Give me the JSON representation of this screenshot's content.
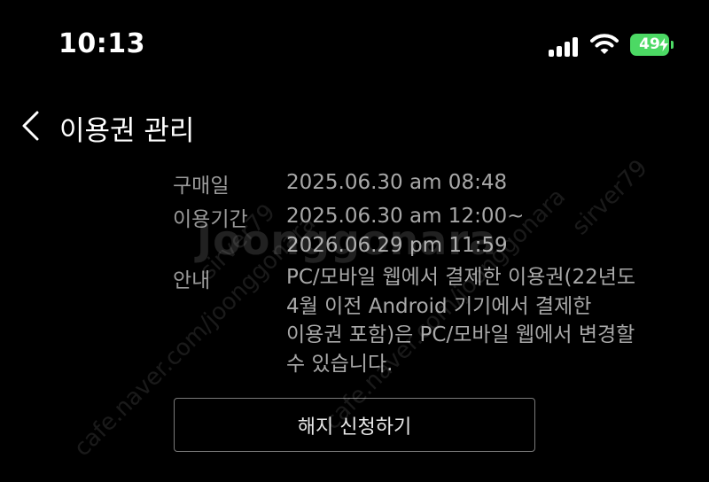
{
  "status_bar": {
    "time": "10:13",
    "battery_level": "49",
    "icons": [
      "signal-icon",
      "wifi-icon",
      "battery-charging-icon"
    ]
  },
  "header": {
    "back_icon": "chevron-left-icon",
    "title": "이용권 관리"
  },
  "info": {
    "purchase_date": {
      "label": "구매일",
      "value": "2025.06.30 am 08:48"
    },
    "usage_period": {
      "label": "이용기간",
      "value_line1": "2025.06.30 am 12:00~",
      "value_line2": "2026.06.29 pm 11:59"
    },
    "notice": {
      "label": "안내",
      "lines": [
        "PC/모바일 웹에서 결제한 이용권(22년도",
        "4월 이전 Android 기기에서 결제한",
        "이용권 포함)은 PC/모바일 웹에서 변경할",
        "수 있습니다."
      ]
    }
  },
  "actions": {
    "cancel_label": "해지 신청하기"
  },
  "watermark": {
    "brand": "Joonggonara",
    "url": "cafe.naver.com/joonggonara",
    "user": "sirver79"
  },
  "colors": {
    "background": "#000000",
    "text_primary": "#ffffff",
    "text_secondary": "#a8a8a8",
    "battery_green": "#4cd964",
    "button_border": "#7a7a7a"
  }
}
